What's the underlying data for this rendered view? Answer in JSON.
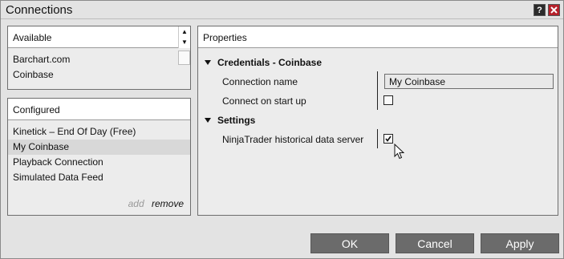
{
  "window": {
    "title": "Connections"
  },
  "titlebar": {
    "help_label": "?",
    "close_label": "x"
  },
  "available": {
    "header": "Available",
    "items": [
      "Barchart.com",
      "Coinbase"
    ]
  },
  "configured": {
    "header": "Configured",
    "items": [
      "Kinetick – End Of Day (Free)",
      "My Coinbase",
      "Playback Connection",
      "Simulated Data Feed"
    ],
    "selected_index": 1,
    "add_label": "add",
    "remove_label": "remove"
  },
  "properties": {
    "header": "Properties",
    "credentials_section": "Credentials - Coinbase",
    "connection_name_label": "Connection name",
    "connection_name_value": "My Coinbase",
    "connect_on_startup_label": "Connect on start up",
    "connect_on_startup_checked": false,
    "settings_section": "Settings",
    "historical_server_label": "NinjaTrader historical data server",
    "historical_server_checked": true
  },
  "buttons": {
    "ok": "OK",
    "cancel": "Cancel",
    "apply": "Apply"
  },
  "colors": {
    "button_bg": "#6b6b6b",
    "close_bg": "#b5202a",
    "help_bg": "#2b2b2b"
  }
}
